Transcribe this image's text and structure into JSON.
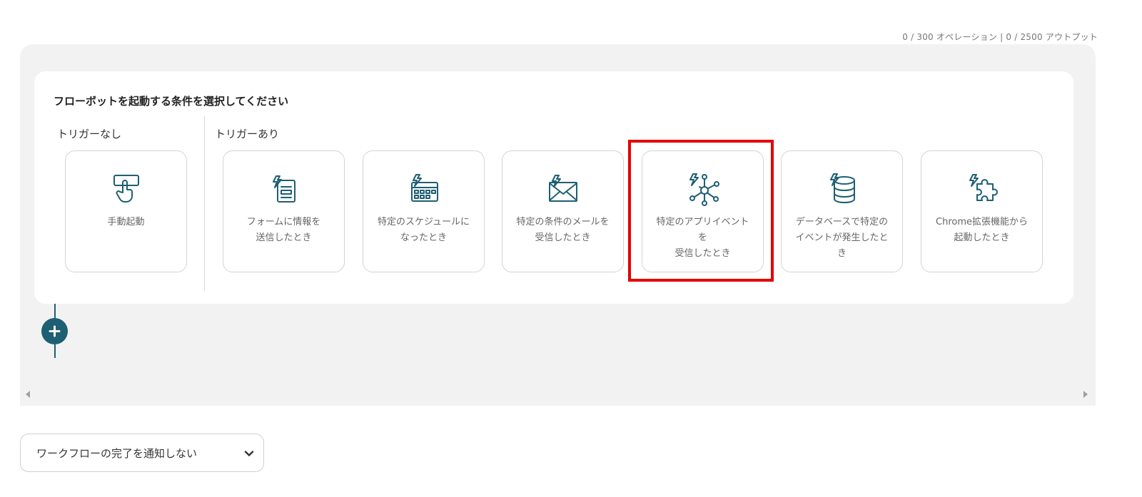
{
  "usage": {
    "text": "0 / 300 オペレーション | 0 / 2500 アウトプット"
  },
  "trigger_panel": {
    "title": "フローボットを起動する条件を選択してください",
    "no_trigger_label": "トリガーなし",
    "trigger_label": "トリガーあり",
    "cards": [
      {
        "label": "手動起動",
        "icon": "hand-press-icon"
      },
      {
        "label": "フォームに情報を\n送信したとき",
        "icon": "form-icon"
      },
      {
        "label": "特定のスケジュールに\nなったとき",
        "icon": "calendar-icon"
      },
      {
        "label": "特定の条件のメールを\n受信したとき",
        "icon": "mail-icon"
      },
      {
        "label": "特定のアプリイベント\nを\n受信したとき",
        "icon": "network-icon"
      },
      {
        "label": "データベースで特定の\nイベントが発生したと\nき",
        "icon": "database-icon"
      },
      {
        "label": "Chrome拡張機能から\n起動したとき",
        "icon": "puzzle-icon"
      }
    ]
  },
  "add_step": {
    "icon": "plus-icon"
  },
  "notify_select": {
    "value": "ワークフローの完了を通知しない",
    "icon": "chevron-down-icon"
  },
  "colors": {
    "accent": "#1e5f74",
    "highlight": "#e30000",
    "canvas_bg": "#f2f2f2"
  }
}
